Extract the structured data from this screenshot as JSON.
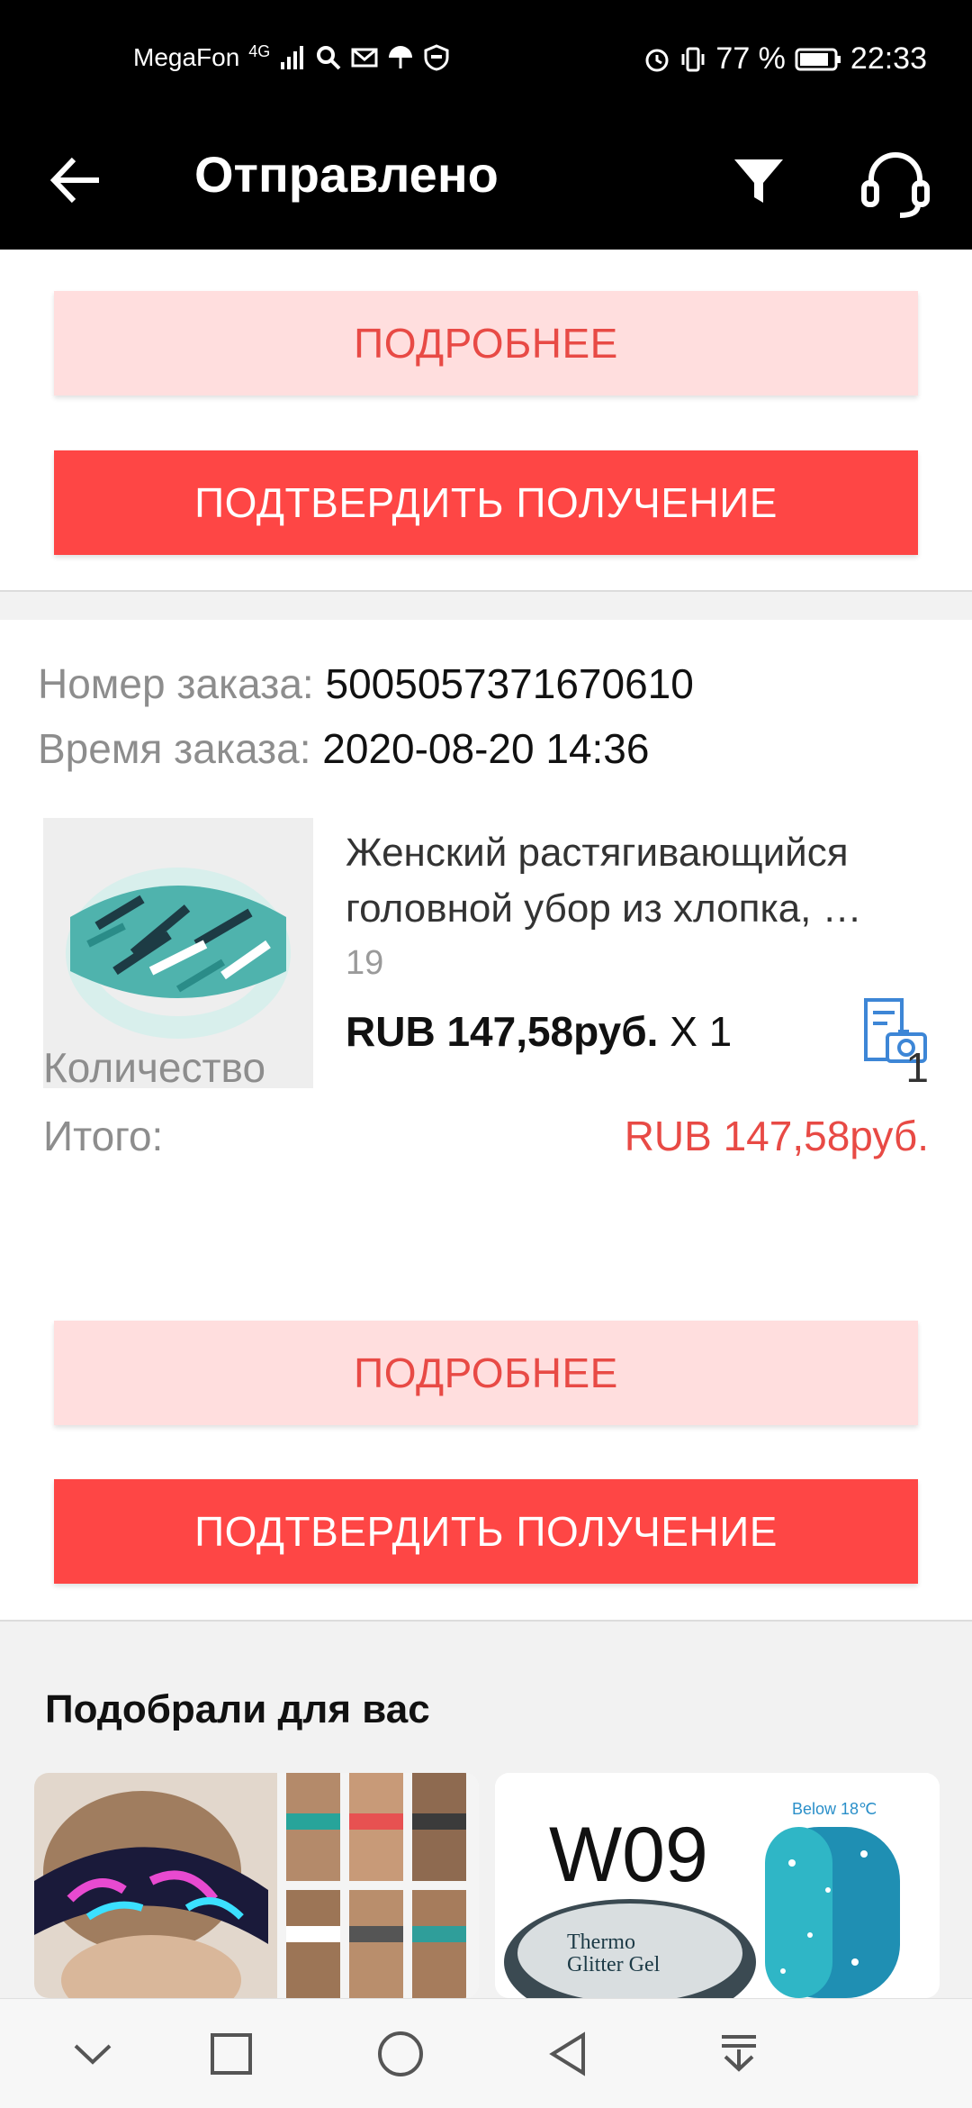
{
  "status_bar": {
    "carrier": "MegaFon",
    "network": "4G",
    "battery": "77 %",
    "time": "22:33"
  },
  "toolbar": {
    "title": "Отправлено"
  },
  "card1": {
    "details_label": "ПОДРОБНЕЕ",
    "confirm_label": "ПОДТВЕРДИТЬ ПОЛУЧЕНИЕ"
  },
  "order": {
    "number_label": "Номер заказа:",
    "number": "5005057371670610",
    "time_label": "Время заказа:",
    "time": "2020-08-20 14:36",
    "product": {
      "title": "Женский растягивающийся головной убор из хлопка, …",
      "sku": "19",
      "price": "RUB 147,58руб.",
      "qty": "X 1"
    },
    "quantity_label": "Количество",
    "quantity": "1",
    "total_label": "Итого:",
    "total": "RUB 147,58руб.",
    "details_label": "ПОДРОБНЕЕ",
    "confirm_label": "ПОДТВЕРДИТЬ ПОЛУЧЕНИЕ"
  },
  "recommendations": {
    "title": "Подобрали для вас",
    "items": [
      {
        "icon": "headband-photo"
      },
      {
        "text": "W09",
        "subtext": "Below 18℃",
        "jar_line1": "Thermo",
        "jar_line2": "Glitter Gel"
      }
    ]
  },
  "colors": {
    "accent_red": "#fe4645",
    "light_red": "#ffdede",
    "price_red": "#e84a45"
  }
}
